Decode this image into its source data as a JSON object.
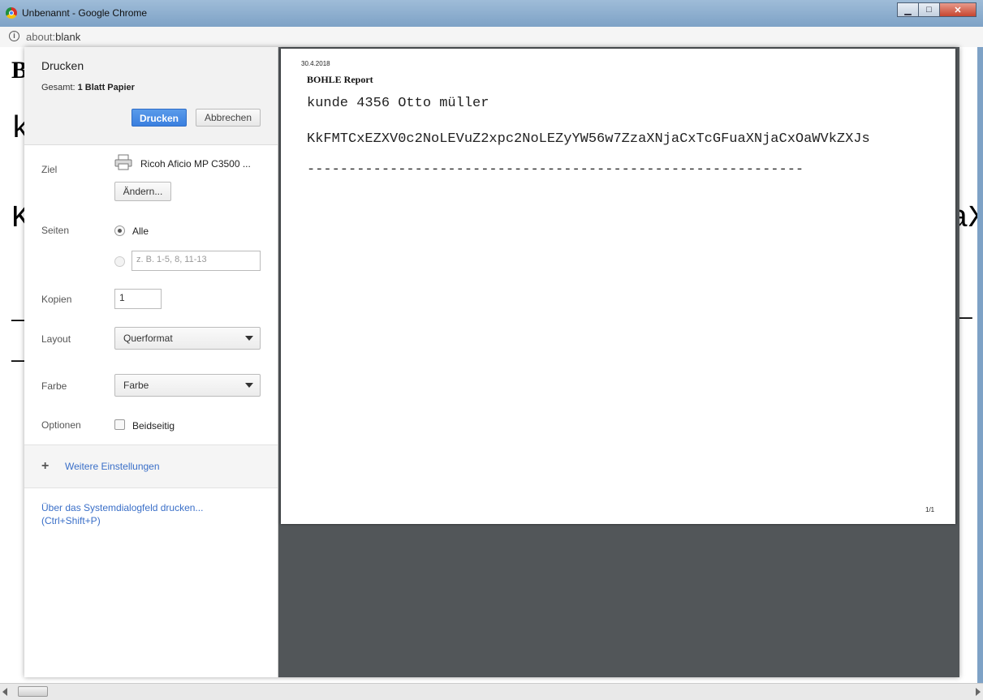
{
  "window": {
    "title": "Unbenannt - Google Chrome",
    "minimize_glyph": "▁",
    "maximize_glyph": "□",
    "close_glyph": "✕"
  },
  "addressbar": {
    "url_scheme": "about:",
    "url_rest": "blank"
  },
  "background_page": {
    "first_letter": "B",
    "line1_char": "k",
    "line2_char": "K",
    "line2_tail": "aX",
    "dash_line": "_\n_",
    "dash_tail": "_"
  },
  "print_dialog": {
    "title": "Drucken",
    "summary_label": "Gesamt: ",
    "summary_value": "1 Blatt Papier",
    "print_button": "Drucken",
    "cancel_button": "Abbrechen",
    "destination": {
      "label": "Ziel",
      "printer": "Ricoh Aficio MP C3500 ...",
      "change_button": "Ändern..."
    },
    "pages": {
      "label": "Seiten",
      "all_option": "Alle",
      "range_placeholder": "z. B. 1-5, 8, 11-13"
    },
    "copies": {
      "label": "Kopien",
      "value": "1"
    },
    "layout": {
      "label": "Layout",
      "selected": "Querformat"
    },
    "color": {
      "label": "Farbe",
      "selected": "Farbe"
    },
    "options": {
      "label": "Optionen",
      "duplex": "Beidseitig"
    },
    "more_settings": "Weitere Einstellungen",
    "system_dialog_line1": "Über das Systemdialogfeld drucken...",
    "system_dialog_line2": "(Ctrl+Shift+P)"
  },
  "preview": {
    "date": "30.4.2018",
    "title": "BOHLE Report",
    "line1": "kunde 4356 Otto müller",
    "line2": "KkFMTCxEZXV0c2NoLEVuZ2xpc2NoLEZyYW56w7ZzaXNjaCxTcGFuaXNjaCxOaWVkZXJs",
    "line3": "------------------------------------------------------------",
    "page_number": "1/1"
  }
}
